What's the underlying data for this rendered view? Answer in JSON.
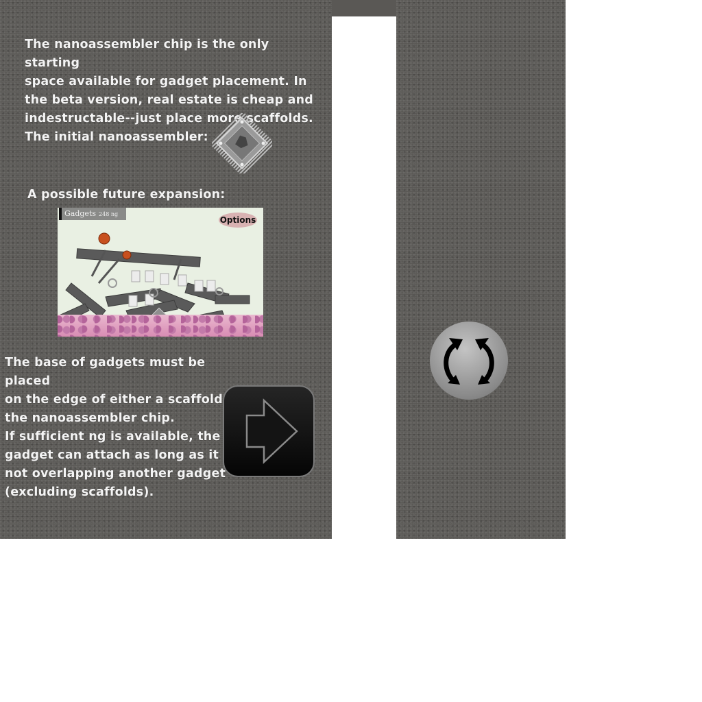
{
  "tutorial": {
    "intro_text": "The nanoassembler chip is the only starting\nspace available for gadget placement. In\nthe beta version, real estate is cheap and\nindestructable--just place more scaffolds.",
    "initial_label": "The initial nanoassembler:",
    "future_label": "A possible future expansion:",
    "rules_text": "The base of gadgets must be placed\non the edge of either a scaffold or\nthe nanoassembler chip.\nIf sufficient ng is available, the\ngadget can attach as long as it is\nnot overlapping another gadget\n(excluding scaffolds)."
  },
  "preview": {
    "gadgets_label": "Gadgets",
    "gadgets_ng": "248 ng",
    "options_label": "Options"
  },
  "icons": {
    "next": "next-arrow-icon",
    "rotate": "rotate-icon",
    "chip": "nanoassembler-chip-icon"
  },
  "colors": {
    "background": "#5a5855",
    "text": "#f4f4f4",
    "preview_bg": "#e9f0e3"
  }
}
